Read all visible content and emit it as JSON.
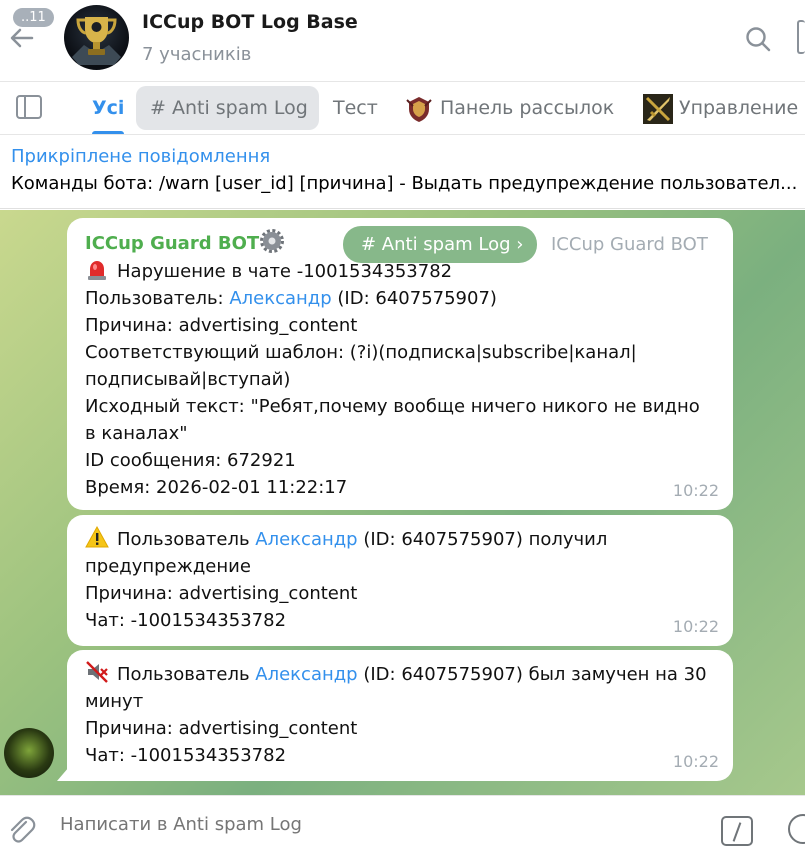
{
  "header": {
    "unread_badge": "..11",
    "title": "ICCup BOT Log Base",
    "subtitle": "7 учасників"
  },
  "tabs": [
    {
      "label": "Усі"
    },
    {
      "label": "# Anti spam Log"
    },
    {
      "label": "Тест"
    },
    {
      "label": "Панель рассылок"
    },
    {
      "label": "Управление"
    }
  ],
  "pinned": {
    "title": "Прикріплене повідомлення",
    "text": "Команды бота: /warn [user_id] [причина] - Выдать предупреждение пользовател..."
  },
  "messages": [
    {
      "sender": "ICCup Guard BOT",
      "topic_pill": "# Anti spam Log ›",
      "forward_name": "ICCup Guard BOT",
      "line1": "Нарушение в чате -1001534353782",
      "line2_prefix": "Пользователь: ",
      "line2_user": "Александр",
      "line2_suffix": " (ID: 6407575907)",
      "line3": "Причина: advertising_content",
      "line4": "Соответствующий шаблон: (?i)(подписка|subscribe|канал|",
      "line5": "подписывай|вступай)",
      "line6": "Исходный текст: \"Ребят,почему вообще ничего никого не видно",
      "line7": "в каналах\"",
      "line8": "ID сообщения: 672921",
      "line9": "Время: 2026-02-01 11:22:17",
      "time": "10:22"
    },
    {
      "prefix": "Пользователь ",
      "user": "Александр",
      "suffix": " (ID: 6407575907) получил",
      "line2": "предупреждение",
      "line3": "Причина: advertising_content",
      "line4": "Чат: -1001534353782",
      "time": "10:22"
    },
    {
      "prefix": "Пользователь ",
      "user": "Александр",
      "suffix": " (ID: 6407575907) был замучен на 30",
      "line2": "минут",
      "line3": "Причина: advertising_content",
      "line4": "Чат: -1001534353782",
      "time": "10:22"
    }
  ],
  "composer": {
    "placeholder": "Написати в Anti spam Log"
  },
  "colors": {
    "accent": "#3390ec",
    "sender": "#4fae4e",
    "topic_pill": "#87b88a"
  }
}
